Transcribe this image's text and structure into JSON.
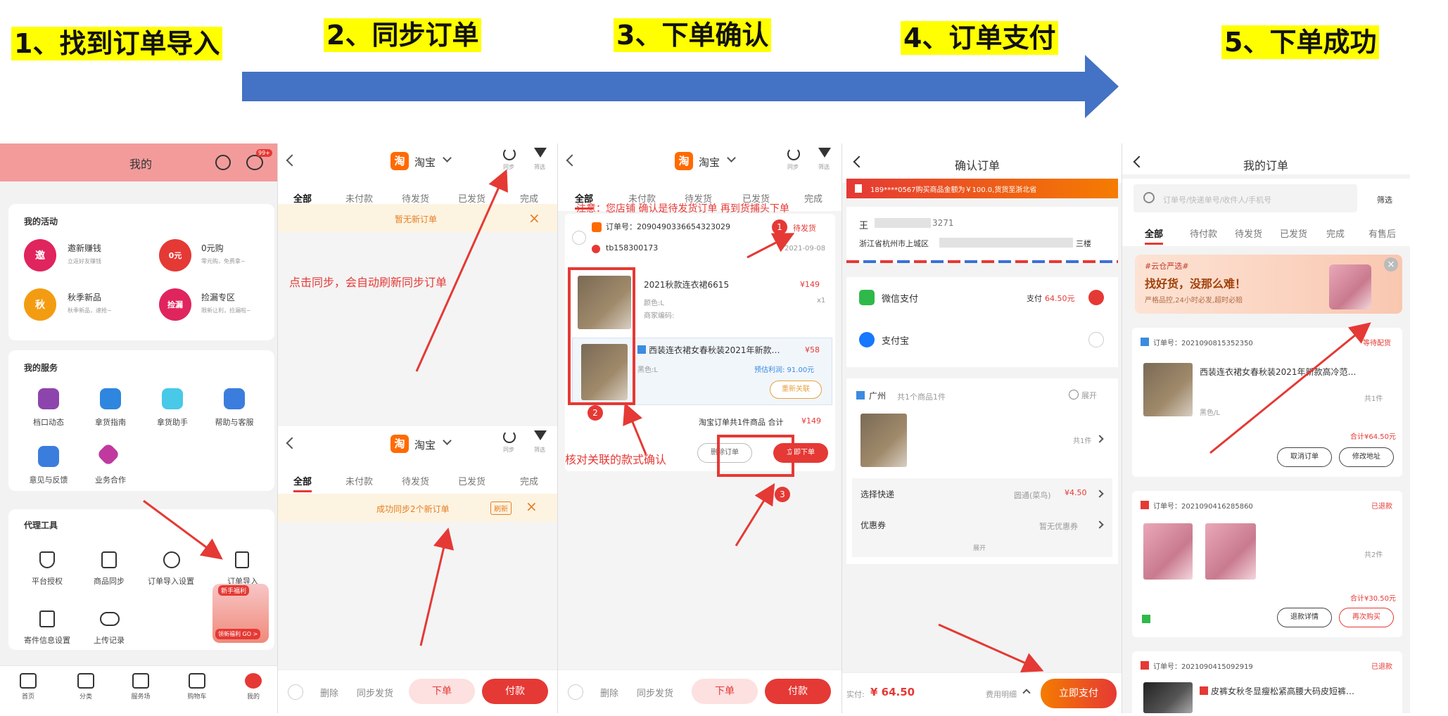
{
  "steps": {
    "s1": "1、找到订单导入",
    "s2": "2、同步订单",
    "s3": "3、下单确认",
    "s4": "4、订单支付",
    "s5": "5、下单成功"
  },
  "p1": {
    "title": "我的",
    "badge": "99+",
    "activities_title": "我的活动",
    "activities": [
      {
        "icon_text": "邀",
        "label": "邀新赚钱",
        "sub": "立返好友赚钱"
      },
      {
        "icon_text": "0元",
        "label": "0元购",
        "sub": "零元购，免费拿~"
      },
      {
        "icon_text": "秋",
        "label": "秋季新品",
        "sub": "秋季新品，速抢~"
      },
      {
        "icon_text": "捡漏",
        "label": "捡漏专区",
        "sub": "限新让利，捡漏啦~"
      }
    ],
    "services_title": "我的服务",
    "services": [
      "档口动态",
      "拿货指南",
      "拿货助手",
      "帮助与客服",
      "意见与反馈",
      "业务合作"
    ],
    "tools_title": "代理工具",
    "tools": [
      "平台授权",
      "商品同步",
      "订单导入设置",
      "订单导入",
      "寄件信息设置",
      "上传记录"
    ],
    "promo_tag": "新手福利",
    "promo_go": "领新福利 GO >",
    "tabbar": [
      "首页",
      "分类",
      "服务场",
      "购物车",
      "我的"
    ]
  },
  "order_app": {
    "platform": "淘宝",
    "sync_label": "同步",
    "filter_label": "筛选",
    "tabs": [
      "全部",
      "未付款",
      "待发货",
      "已发货",
      "完成"
    ],
    "bottom": {
      "delete": "删除",
      "sync_ship": "同步发货",
      "order": "下单",
      "pay": "付款"
    }
  },
  "p2": {
    "no_orders": "暂无新订单",
    "annotation": "点击同步，会自动刷新同步订单",
    "synced": "成功同步2个新订单",
    "refresh": "刷新"
  },
  "p3": {
    "annotation_top": "注意：您店铺 确认是待发货订单 再到货捕头下单",
    "order_no": "订单号：2090490336654323029",
    "status": "待发货",
    "buyer": "tb158300173",
    "date": "2021-09-08",
    "item1_title": "2021秋款连衣裙6615",
    "item1_price": "¥149",
    "item1_spec": "颜色:L",
    "item1_qty": "x1",
    "item1_code": "商家编码:",
    "item2_title": "西装连衣裙女春秋装2021年新款…",
    "item2_price": "¥58",
    "item2_spec": "黑色:L",
    "item2_profit": "预估利润: 91.00元",
    "item2_relink": "重新关联",
    "summary": "淘宝订单共1件商品 合计",
    "summary_price": "¥149",
    "delete_order": "删除订单",
    "place_order": "立即下单",
    "annotation_bottom": "核对关联的款式确认",
    "n1": "1",
    "n2": "2",
    "n3": "3"
  },
  "p4": {
    "title": "确认订单",
    "banner": "189****0567购买商品金额为￥100.0,货货至浙北省",
    "receiver": "王",
    "phone": "3271",
    "address": "浙江省杭州市上城区",
    "address_tail": "三楼",
    "wechat": "微信支付",
    "wechat_pay": "支付",
    "wechat_amount": "64.50元",
    "alipay": "支付宝",
    "store": "广州",
    "store_count": "共1个商品1件",
    "expand": "展开",
    "qty": "共1件",
    "express_label": "选择快递",
    "express_value": "圆通(菜鸟)",
    "express_price": "¥4.50",
    "coupon_label": "优惠券",
    "coupon_value": "暂无优惠券",
    "expand2": "展开",
    "pay_label": "实付:",
    "pay_amount": "¥ 64.50",
    "fee_detail": "费用明细",
    "pay_now": "立即支付"
  },
  "p5": {
    "title": "我的订单",
    "search_placeholder": "订单号/快递单号/收件人/手机号",
    "filter": "筛选",
    "tabs": [
      "全部",
      "待付款",
      "待发货",
      "已发货",
      "完成",
      "有售后"
    ],
    "promo_tag": "#云仓严选#",
    "promo_title": "找好货，没那么难！",
    "promo_sub": "严格品控,24小时必发,超时必赔",
    "orders": [
      {
        "no": "订单号：20210908153523​50",
        "status": "等待配货",
        "title": "西装连衣裙女春秋装2021年新款高冷范…",
        "spec": "黑色/L",
        "qty": "共1件",
        "total": "合计¥64.50元",
        "btn1": "取消订单",
        "btn2": "修改地址"
      },
      {
        "no": "订单号：20210904162858​60",
        "status": "已退款",
        "title": "",
        "spec": "",
        "qty": "共2件",
        "total": "合计¥30.50元",
        "btn1": "退款详情",
        "btn2": "再次购买"
      },
      {
        "no": "订单号：20210904150929​19",
        "status": "已退款",
        "title": "皮裤女秋冬显瘦松紧高腰大码皮短裤…",
        "spec": "",
        "qty": "",
        "total": "",
        "btn1": "",
        "btn2": ""
      }
    ]
  }
}
